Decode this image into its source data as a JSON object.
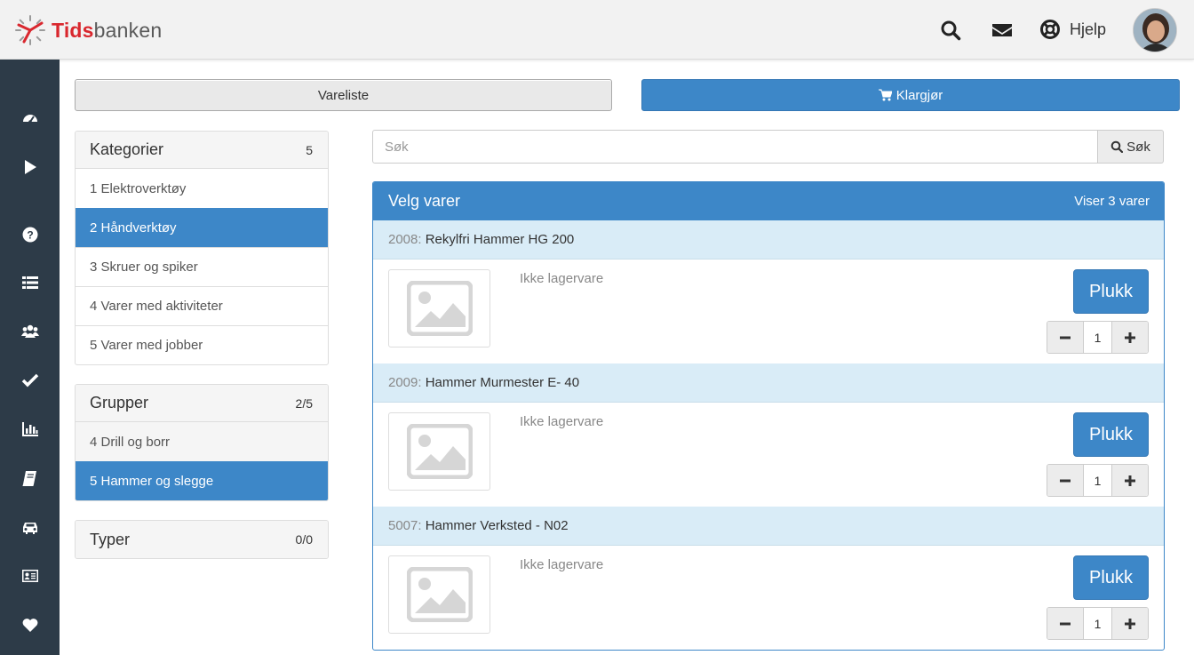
{
  "app": {
    "brand_part1": "Tids",
    "brand_part2": "banken"
  },
  "header": {
    "icons": [
      "search-icon",
      "envelope-icon",
      "lifebuoy-icon"
    ],
    "help_label": "Hjelp"
  },
  "sidenav": {
    "items": [
      "dashboard-icon",
      "play-icon",
      "question-icon",
      "list-icon",
      "users-icon",
      "check-icon",
      "bar-chart-icon",
      "book-icon",
      "car-icon",
      "id-card-icon",
      "heart-icon"
    ]
  },
  "actions": {
    "vareliste_label": "Vareliste",
    "klargjor_label": "Klargjør"
  },
  "categories": {
    "title": "Kategorier",
    "count": "5",
    "items": [
      {
        "label": "1 Elektroverktøy",
        "active": false
      },
      {
        "label": "2 Håndverktøy",
        "active": true
      },
      {
        "label": "3 Skruer og spiker",
        "active": false
      },
      {
        "label": "4 Varer med aktiviteter",
        "active": false
      },
      {
        "label": "5 Varer med jobber",
        "active": false
      }
    ]
  },
  "groups": {
    "title": "Grupper",
    "count": "2/5",
    "items": [
      {
        "label": "4 Drill og borr",
        "active": false
      },
      {
        "label": "5 Hammer og slegge",
        "active": true
      }
    ]
  },
  "types": {
    "title": "Typer",
    "count": "0/0"
  },
  "search": {
    "placeholder": "Søk",
    "button_label": "Søk"
  },
  "products": {
    "title": "Velg varer",
    "count_label": "Viser 3 varer",
    "items": [
      {
        "code": "2008:",
        "name": "Rekylfri Hammer HG 200",
        "stock": "Ikke lagervare",
        "pick_label": "Plukk",
        "quantity": "1"
      },
      {
        "code": "2009:",
        "name": "Hammer Murmester E- 40",
        "stock": "Ikke lagervare",
        "pick_label": "Plukk",
        "quantity": "1"
      },
      {
        "code": "5007:",
        "name": "Hammer Verksted - N02",
        "stock": "Ikke lagervare",
        "pick_label": "Plukk",
        "quantity": "1"
      }
    ]
  },
  "colors": {
    "primary": "#3d87c8",
    "sidenav": "#2d3b48",
    "brand_red": "#d9272e",
    "item_header": "#d9ecf7"
  }
}
